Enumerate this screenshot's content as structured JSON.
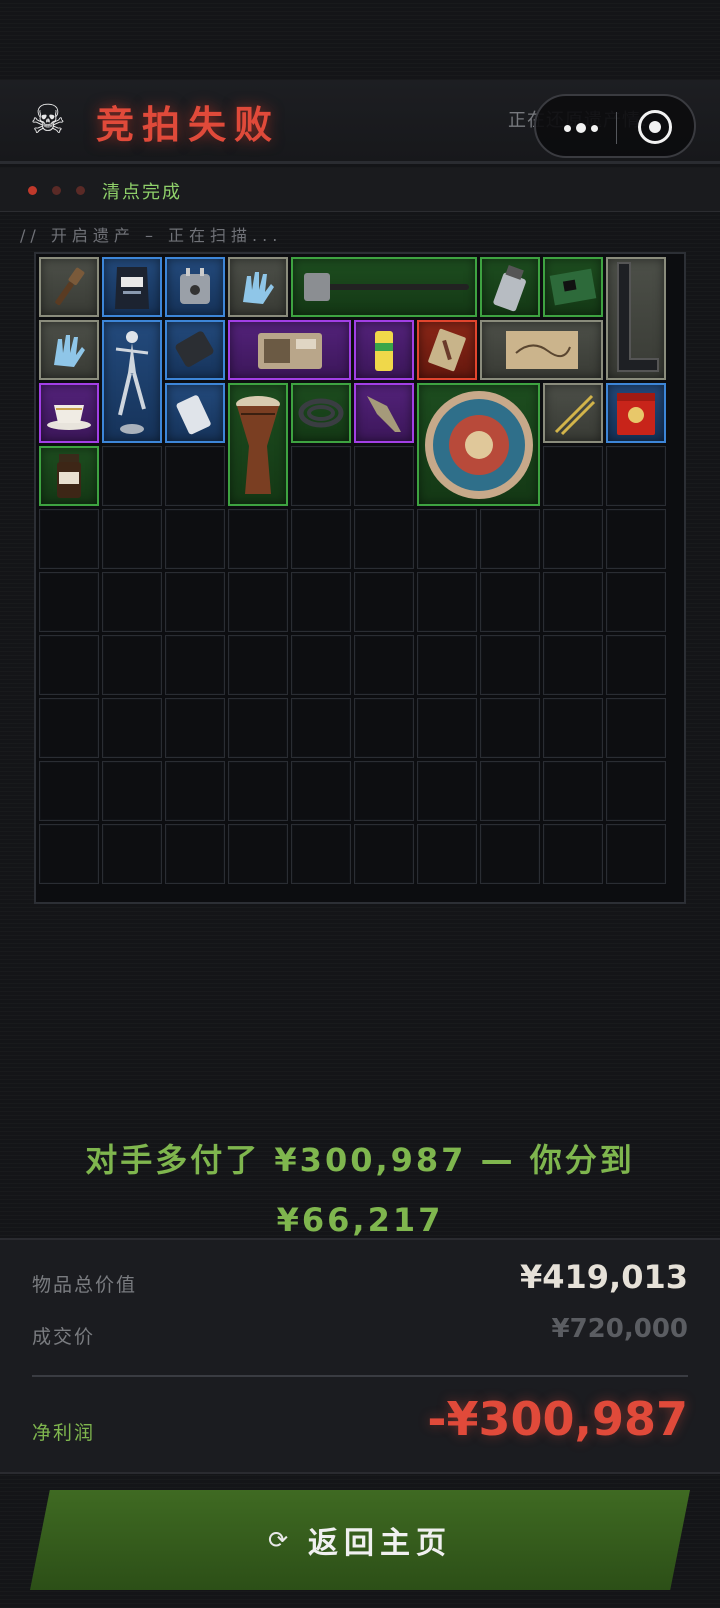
{
  "header": {
    "skull_icon": "skull-icon",
    "title": "竞拍失败",
    "status": "正在还原遗产情..."
  },
  "capsule": {
    "more_icon": "more-dots-icon",
    "close_icon": "target-close-icon"
  },
  "stage": {
    "dots": [
      "#c0392b",
      "#5a2a26",
      "#5a2a26"
    ],
    "label": "清点完成"
  },
  "scan_line": "//  开启遗产 – 正在扫描...",
  "result": {
    "message": "对手多付了 ¥300,987 — 你分到 ¥66,217"
  },
  "summary": {
    "total_label": "物品总价值",
    "total_value": "¥419,013",
    "deal_label": "成交价",
    "deal_value": "¥720,000",
    "profit_label": "净利润",
    "profit_value": "-¥300,987"
  },
  "home_button": {
    "icon": "refresh-icon",
    "label": "返回主页"
  },
  "colors": {
    "danger": "#e04a3a",
    "accent_green": "#7fb64e",
    "rarity_grey": "#8a8c7c",
    "rarity_blue": "#3d86d8",
    "rarity_green": "#3ea341",
    "rarity_purple": "#a23fe6",
    "rarity_red": "#e2452e"
  },
  "inventory": {
    "grid_cols": 10,
    "grid_rows": 10,
    "items": [
      {
        "name": "paintbrush",
        "rarity": "grey"
      },
      {
        "name": "coffee-bag",
        "rarity": "blue"
      },
      {
        "name": "travel-adapter",
        "rarity": "blue"
      },
      {
        "name": "rubber-gloves",
        "rarity": "grey"
      },
      {
        "name": "sledgehammer",
        "rarity": "green"
      },
      {
        "name": "lighter",
        "rarity": "green"
      },
      {
        "name": "circuit-board",
        "rarity": "green"
      },
      {
        "name": "metal-bracket",
        "rarity": "grey"
      },
      {
        "name": "rubber-gloves",
        "rarity": "grey"
      },
      {
        "name": "ballerina-statue",
        "rarity": "blue"
      },
      {
        "name": "power-bank",
        "rarity": "blue"
      },
      {
        "name": "vintage-radio",
        "rarity": "purple"
      },
      {
        "name": "drink-can",
        "rarity": "purple"
      },
      {
        "name": "ornate-tile",
        "rarity": "red"
      },
      {
        "name": "old-map",
        "rarity": "grey"
      },
      {
        "name": "teacup",
        "rarity": "purple"
      },
      {
        "name": "mp3-player",
        "rarity": "blue"
      },
      {
        "name": "djembe-drum",
        "rarity": "green"
      },
      {
        "name": "coiled-hose",
        "rarity": "green"
      },
      {
        "name": "spearhead",
        "rarity": "purple"
      },
      {
        "name": "decorative-plate",
        "rarity": "green"
      },
      {
        "name": "chopsticks",
        "rarity": "grey"
      },
      {
        "name": "red-tin-box",
        "rarity": "blue"
      },
      {
        "name": "coffee-jar",
        "rarity": "green"
      }
    ]
  }
}
